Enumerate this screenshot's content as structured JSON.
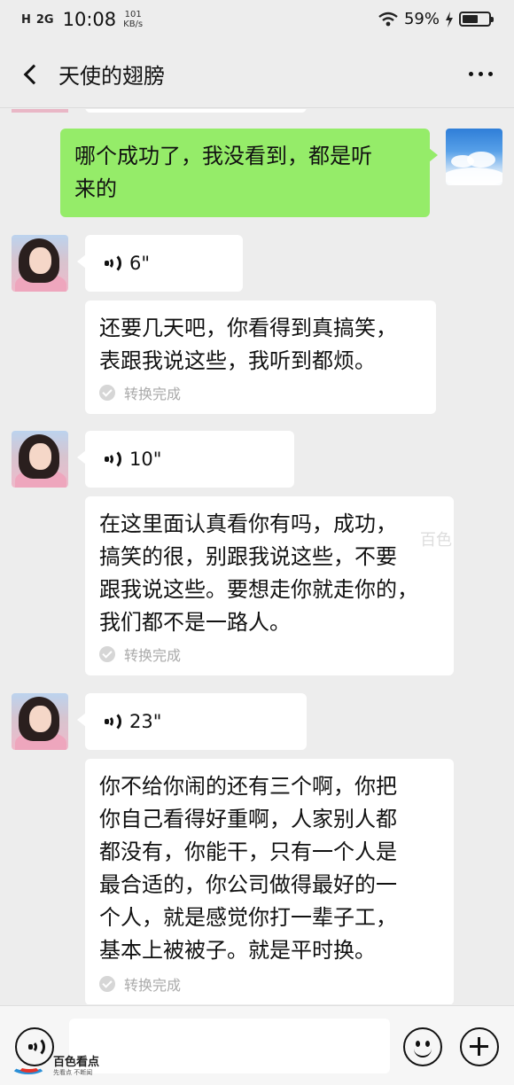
{
  "status_bar": {
    "network_1": "H",
    "network_2": "2G",
    "time": "10:08",
    "speed_value": "101",
    "speed_unit": "KB/s",
    "battery_percent": "59%",
    "battery_level": 0.59
  },
  "header": {
    "title": "天使的翅膀",
    "back_icon": "chevron-left-icon",
    "more_icon": "more-dots-icon"
  },
  "messages": [
    {
      "sender": "me",
      "type": "text",
      "text": "哪个成功了，我没看到，都是听来的",
      "lines": [
        "哪个成功了，我没看到，都是听",
        "来的"
      ]
    },
    {
      "sender": "other",
      "type": "voice",
      "duration": "6\"",
      "transcript_lines": [
        "还要几天吧，你看得到真搞笑，",
        "表跟我说这些，我听到都烦。"
      ],
      "status": "转换完成"
    },
    {
      "sender": "other",
      "type": "voice",
      "duration": "10\"",
      "transcript_lines": [
        "在这里面认真看你有吗，成功，",
        "搞笑的很，别跟我说这些，不要",
        "跟我说这些。要想走你就走你的，",
        "我们都不是一路人。"
      ],
      "status": "转换完成"
    },
    {
      "sender": "other",
      "type": "voice",
      "duration": "23\"",
      "transcript_lines": [
        "你不给你闹的还有三个啊，你把",
        "你自己看得好重啊，人家别人都",
        "都没有，你能干，只有一个人是",
        "最合适的，你公司做得最好的一",
        "个人，就是感觉你打一辈子工，",
        "基本上被被子。就是平时换。"
      ],
      "status": "转换完成"
    }
  ],
  "watermark": {
    "mid_text": "百色",
    "brand_name": "百色看点",
    "brand_slogan": "先看点 不断闻"
  },
  "input_bar": {
    "voice_icon": "voice-toggle-icon",
    "emoji_icon": "emoji-icon",
    "plus_icon": "plus-icon"
  }
}
